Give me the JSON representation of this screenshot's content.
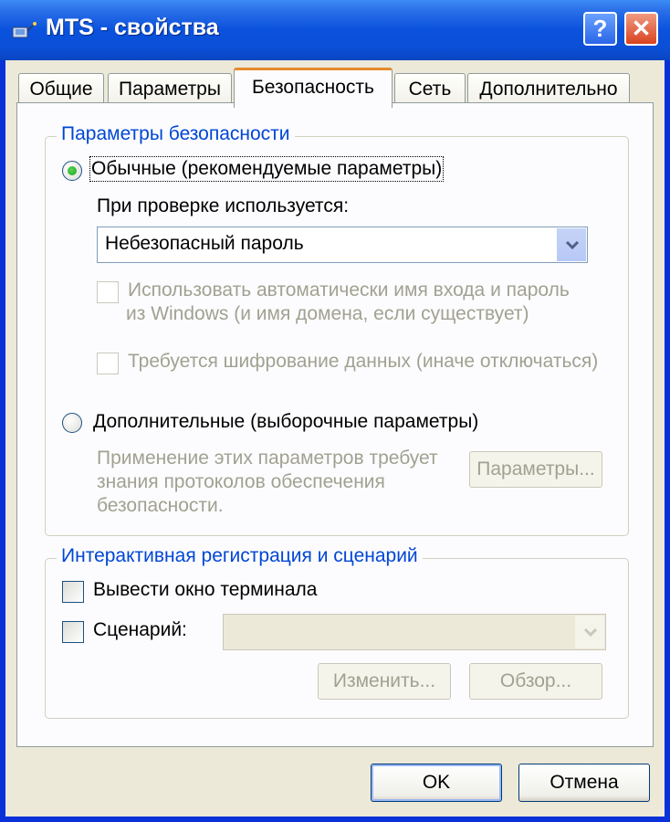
{
  "window": {
    "title": "MTS - свойства",
    "help_button": "?",
    "close_button": "✕"
  },
  "tabs": [
    {
      "label": "Общие"
    },
    {
      "label": "Параметры"
    },
    {
      "label": "Безопасность"
    },
    {
      "label": "Сеть"
    },
    {
      "label": "Дополнительно"
    }
  ],
  "security_group": {
    "title": "Параметры безопасности",
    "typical_radio": {
      "label": "Обычные (рекомендуемые параметры)",
      "checked": true
    },
    "validate_label": "При проверке используется:",
    "validate_select": {
      "value": "Небезопасный пароль"
    },
    "auto_login_checkbox": {
      "label_line1": "Использовать автоматически имя входа и пароль",
      "label_line2": "из Windows (и имя домена, если существует)",
      "checked": false
    },
    "encryption_checkbox": {
      "label": "Требуется шифрование данных (иначе отключаться)",
      "checked": false
    },
    "advanced_radio": {
      "label": "Дополнительные (выборочные параметры)",
      "checked": false
    },
    "advanced_desc": {
      "line1": "Применение этих параметров требует",
      "line2": "знания протоколов обеспечения",
      "line3": "безопасности."
    },
    "settings_button": "Параметры..."
  },
  "scripting_group": {
    "title": "Интерактивная регистрация и сценарий",
    "terminal_checkbox": {
      "label": "Вывести окно терминала",
      "checked": false
    },
    "script_checkbox": {
      "label": "Сценарий:",
      "checked": false
    },
    "script_select": {
      "value": ""
    },
    "edit_button": "Изменить...",
    "browse_button": "Обзор..."
  },
  "footer": {
    "ok_button": "OK",
    "cancel_button": "Отмена"
  },
  "colors": {
    "title_bar": "#0a52dd",
    "dialog_bg": "#ece9d8",
    "panel_bg": "#fcfcfe",
    "group_title": "#0046d5",
    "active_tab_accent": "#e68b2c"
  }
}
